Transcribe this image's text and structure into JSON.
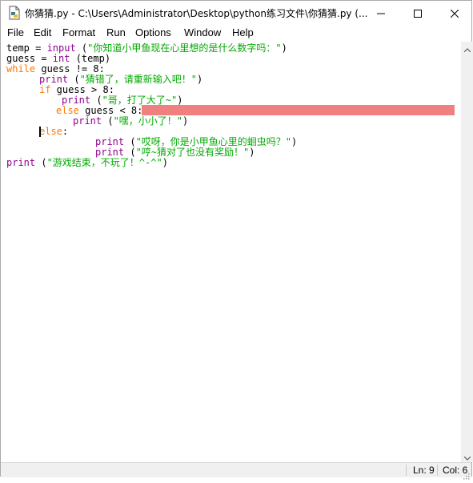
{
  "window": {
    "title": "你猜猜.py - C:\\Users\\Administrator\\Desktop\\python练习文件\\你猜猜.py (..."
  },
  "menu": [
    {
      "label": "File"
    },
    {
      "label": "Edit"
    },
    {
      "label": "Format"
    },
    {
      "label": "Run"
    },
    {
      "label": "Options"
    },
    {
      "label": "Window"
    },
    {
      "label": "Help"
    }
  ],
  "code": {
    "l1": {
      "t1": "temp = ",
      "b1": "input",
      "t2": " (",
      "s1": "\"你知道小甲鱼现在心里想的是什么数字吗：\"",
      "t3": ")"
    },
    "l2": {
      "t1": "guess = ",
      "b1": "int",
      "t2": " (temp)"
    },
    "l3": {
      "k1": "while",
      "t1": " guess != 8:"
    },
    "l4": {
      "b1": "print",
      "t1": " (",
      "s1": "\"猜错了，请重新输入吧！\"",
      "t2": ")"
    },
    "l5": {
      "k1": "if",
      "t1": " guess > 8:"
    },
    "l6": {
      "b1": "print",
      "t1": " (",
      "s1": "\"哥，打了大了~\"",
      "t2": ")"
    },
    "l7": {
      "k1": "else",
      "t1": " guess < 8:"
    },
    "l8": {
      "b1": "print",
      "t1": " (",
      "s1": "\"嘿，小小了！\"",
      "t2": ")"
    },
    "l9": {
      "k1": "else",
      "t1": ":"
    },
    "l10": {
      "b1": "print",
      "t1": " (",
      "s1": "\"哎呀，你是小甲鱼心里的蛔虫吗？\"",
      "t2": ")"
    },
    "l11": {
      "b1": "print",
      "t1": " (",
      "s1": "\"哼~猜对了也没有奖励！\"",
      "t2": ")"
    },
    "l12": {
      "b1": "print",
      "t1": " (",
      "s1": "\"游戏结束，不玩了！^-^\"",
      "t2": ")"
    }
  },
  "status": {
    "line": "Ln: 9",
    "col": "Col: 6"
  },
  "colors": {
    "keyword": "#ff7700",
    "builtin": "#900090",
    "string": "#00aa00",
    "redaction": "#f08080"
  }
}
